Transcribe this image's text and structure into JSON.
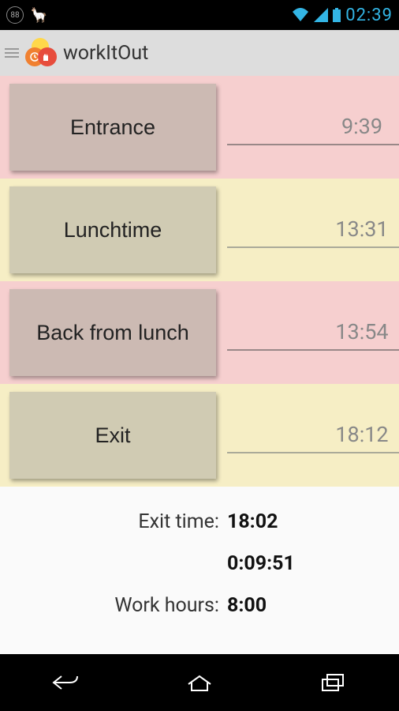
{
  "statusbar": {
    "battery": "88",
    "clock": "02:39"
  },
  "app": {
    "title": "workItOut"
  },
  "rows": [
    {
      "label": "Entrance",
      "time": "9:39",
      "bg": "pink",
      "icon": "factory"
    },
    {
      "label": "Lunchtime",
      "time": "13:31",
      "bg": "yellow",
      "icon": "burger"
    },
    {
      "label": "Back from lunch",
      "time": "13:54",
      "bg": "pink",
      "icon": "factory"
    },
    {
      "label": "Exit",
      "time": "18:12",
      "bg": "yellow",
      "icon": "clock"
    }
  ],
  "summary": {
    "exit_label": "Exit time:",
    "exit_value": "18:02",
    "overtime": "0:09:51",
    "work_label": "Work hours:",
    "work_value": "8:00"
  }
}
